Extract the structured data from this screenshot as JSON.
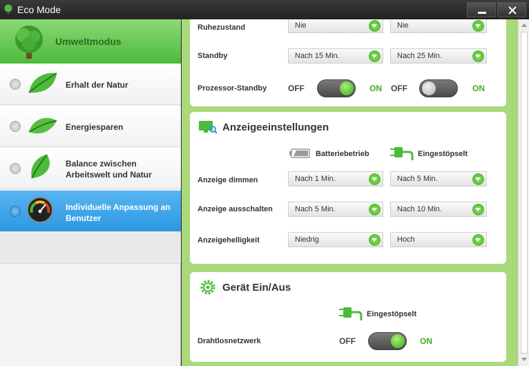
{
  "window": {
    "title": "Eco Mode"
  },
  "sidebar": {
    "header": "Umweltmodus",
    "items": [
      {
        "label": "Erhalt der Natur",
        "icon": "leaf-icon",
        "active": false
      },
      {
        "label": "Energiesparen",
        "icon": "leaf-icon",
        "active": false
      },
      {
        "label": "Balance zwischen Arbeitswelt und Natur",
        "icon": "leaf-icon",
        "active": false
      },
      {
        "label": "Individuelle Anpassung an Benutzer",
        "icon": "gauge-icon",
        "active": true
      }
    ]
  },
  "power": {
    "rows": [
      {
        "label": "Ruhezustand",
        "battery": "Nie",
        "plugged": "Nie"
      },
      {
        "label": "Standby",
        "battery": "Nach 15 Min.",
        "plugged": "Nach 25 Min."
      }
    ],
    "processor_standby": {
      "label": "Prozessor-Standby",
      "off": "OFF",
      "on": "ON",
      "battery_state": "on",
      "plugged_state": "off"
    }
  },
  "display": {
    "title": "Anzeigeeinstellungen",
    "col_battery": "Batteriebetrieb",
    "col_plugged": "Eingestöpselt",
    "rows": [
      {
        "label": "Anzeige dimmen",
        "battery": "Nach 1 Min.",
        "plugged": "Nach 5 Min."
      },
      {
        "label": "Anzeige ausschalten",
        "battery": "Nach 5 Min.",
        "plugged": "Nach 10 Min."
      },
      {
        "label": "Anzeigehelligkeit",
        "battery": "Niedrig",
        "plugged": "Hoch"
      }
    ]
  },
  "device": {
    "title": "Gerät Ein/Aus",
    "col_plugged": "Eingestöpselt",
    "wireless": {
      "label": "Drahtlosnetzwerk",
      "off": "OFF",
      "on": "ON",
      "state": "on"
    }
  },
  "colors": {
    "accent_green": "#3fae1d",
    "active_blue": "#2b98e3",
    "panel_green": "#a9d97a"
  }
}
